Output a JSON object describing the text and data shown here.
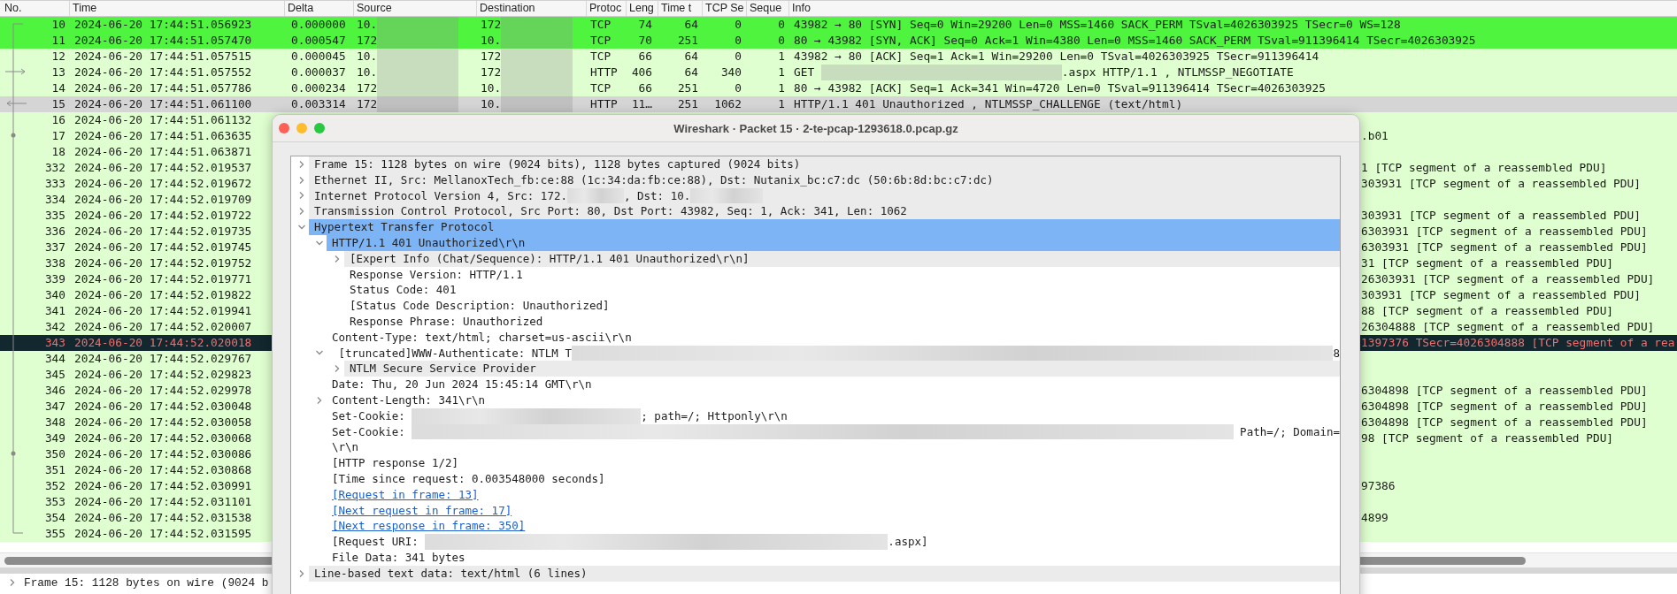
{
  "packet_list": {
    "columns": [
      "No.",
      "Time",
      "Delta",
      "Source",
      "Destination",
      "Protoc",
      "Leng",
      "Time t",
      "TCP Se",
      "Seque",
      "Info"
    ],
    "rows": [
      {
        "kind": "full",
        "cells": [
          "10",
          "2024-06-20 17:44:51.056923",
          "0.000000",
          "10.",
          "172",
          "TCP",
          "74",
          "64",
          "0",
          "0"
        ],
        "info": [
          {
            "text": "43982 → 80 [SYN] Seq=0 Win=29200 Len=0 MSS=1460 SACK_PERM TSval=4026303925 TSecr=0 WS=128"
          }
        ],
        "color": "#4ef43e",
        "selected": false
      },
      {
        "kind": "full",
        "cells": [
          "11",
          "2024-06-20 17:44:51.057470",
          "0.000547",
          "172",
          "10.",
          "TCP",
          "70",
          "251",
          "0",
          "0"
        ],
        "info": [
          {
            "text": "80 → 43982 [SYN, ACK] Seq=0 Ack=1 Win=4380 Len=0 MSS=1460 SACK_PERM TSval=911396414 TSecr=4026303925"
          }
        ],
        "color": "#4ef43e",
        "selected": false
      },
      {
        "kind": "full",
        "cells": [
          "12",
          "2024-06-20 17:44:51.057515",
          "0.000045",
          "10.",
          "172",
          "TCP",
          "66",
          "64",
          "0",
          "1"
        ],
        "info": [
          {
            "text": "43982 → 80 [ACK] Seq=1 Ack=1 Win=29200 Len=0 TSval=4026303925 TSecr=911396414"
          }
        ],
        "color": "#e0ffd0",
        "selected": false
      },
      {
        "kind": "full",
        "cells": [
          "13",
          "2024-06-20 17:44:51.057552",
          "0.000037",
          "10.",
          "172",
          "HTTP",
          "406",
          "64",
          "340",
          "1"
        ],
        "info": [
          {
            "text": "GET "
          },
          {
            "kind": "blur"
          },
          {
            "text": ".aspx HTTP/1.1 , NTLMSSP_NEGOTIATE"
          }
        ],
        "color": "#e0ffd0",
        "selected": false
      },
      {
        "kind": "full",
        "cells": [
          "14",
          "2024-06-20 17:44:51.057786",
          "0.000234",
          "172",
          "10.",
          "TCP",
          "66",
          "251",
          "0",
          "1"
        ],
        "info": [
          {
            "text": "80 → 43982 [ACK] Seq=1 Ack=341 Win=4720 Len=0 TSval=911396414 TSecr=4026303925"
          }
        ],
        "color": "#e0ffd0",
        "selected": false
      },
      {
        "kind": "full",
        "cells": [
          "15",
          "2024-06-20 17:44:51.061100",
          "0.003314",
          "172",
          "10.",
          "HTTP",
          "11…",
          "251",
          "1062",
          "1"
        ],
        "info": [
          {
            "text": "HTTP/1.1 401 Unauthorized , NTLMSSP_CHALLENGE (text/html)"
          }
        ],
        "selected": true
      },
      {
        "kind": "covered",
        "cells": [
          "16",
          "2024-06-20 17:44:51.061132"
        ],
        "color": "#e0ffd0",
        "selected": false
      },
      {
        "kind": "covered",
        "cells": [
          "17",
          "2024-06-20 17:44:51.063635"
        ],
        "info": [
          {
            "text": ".b01"
          }
        ],
        "color": "#e0ffd0",
        "selected": false
      },
      {
        "kind": "covered",
        "cells": [
          "18",
          "2024-06-20 17:44:51.063871"
        ],
        "color": "#e0ffd0",
        "selected": false
      },
      {
        "kind": "covered",
        "cells": [
          "332",
          "2024-06-20 17:44:52.019537"
        ],
        "info": [
          {
            "text": "1 [TCP segment of a reassembled PDU]"
          }
        ],
        "color": "#e0ffd0",
        "selected": false
      },
      {
        "kind": "covered",
        "cells": [
          "333",
          "2024-06-20 17:44:52.019672"
        ],
        "info": [
          {
            "text": "303931 [TCP segment of a reassembled PDU]"
          }
        ],
        "color": "#e0ffd0",
        "selected": false
      },
      {
        "kind": "covered",
        "cells": [
          "334",
          "2024-06-20 17:44:52.019709"
        ],
        "color": "#e0ffd0",
        "selected": false
      },
      {
        "kind": "covered",
        "cells": [
          "335",
          "2024-06-20 17:44:52.019722"
        ],
        "info": [
          {
            "text": "303931 [TCP segment of a reassembled PDU]"
          }
        ],
        "color": "#e0ffd0",
        "selected": false
      },
      {
        "kind": "covered",
        "cells": [
          "336",
          "2024-06-20 17:44:52.019735"
        ],
        "info": [
          {
            "text": "6303931 [TCP segment of a reassembled PDU]"
          }
        ],
        "color": "#e0ffd0",
        "selected": false
      },
      {
        "kind": "covered",
        "cells": [
          "337",
          "2024-06-20 17:44:52.019745"
        ],
        "info": [
          {
            "text": "6303931 [TCP segment of a reassembled PDU]"
          }
        ],
        "color": "#e0ffd0",
        "selected": false
      },
      {
        "kind": "covered",
        "cells": [
          "338",
          "2024-06-20 17:44:52.019752"
        ],
        "info": [
          {
            "text": "31 [TCP segment of a reassembled PDU]"
          }
        ],
        "color": "#e0ffd0",
        "selected": false
      },
      {
        "kind": "covered",
        "cells": [
          "339",
          "2024-06-20 17:44:52.019771"
        ],
        "info": [
          {
            "text": "26303931 [TCP segment of a reassembled PDU]"
          }
        ],
        "color": "#e0ffd0",
        "selected": false
      },
      {
        "kind": "covered",
        "cells": [
          "340",
          "2024-06-20 17:44:52.019822"
        ],
        "info": [
          {
            "text": "303931 [TCP segment of a reassembled PDU]"
          }
        ],
        "color": "#e0ffd0",
        "selected": false
      },
      {
        "kind": "covered",
        "cells": [
          "341",
          "2024-06-20 17:44:52.019941"
        ],
        "info": [
          {
            "text": "88 [TCP segment of a reassembled PDU]"
          }
        ],
        "color": "#e0ffd0",
        "selected": false
      },
      {
        "kind": "covered",
        "cells": [
          "342",
          "2024-06-20 17:44:52.020007"
        ],
        "info": [
          {
            "text": "26304888 [TCP segment of a reassembled PDU]"
          }
        ],
        "color": "#e0ffd0",
        "selected": false
      },
      {
        "kind": "covered",
        "cells": [
          "343",
          "2024-06-20 17:44:52.020018"
        ],
        "info": [
          {
            "text": "1397376 TSecr=4026304888 [TCP segment of a rea"
          }
        ],
        "color": "#12272e",
        "error": true,
        "selected": false
      },
      {
        "kind": "covered",
        "cells": [
          "344",
          "2024-06-20 17:44:52.029767"
        ],
        "color": "#e0ffd0",
        "selected": false
      },
      {
        "kind": "covered",
        "cells": [
          "345",
          "2024-06-20 17:44:52.029823"
        ],
        "color": "#e0ffd0",
        "selected": false
      },
      {
        "kind": "covered",
        "cells": [
          "346",
          "2024-06-20 17:44:52.029978"
        ],
        "info": [
          {
            "text": "6304898 [TCP segment of a reassembled PDU]"
          }
        ],
        "color": "#e0ffd0",
        "selected": false
      },
      {
        "kind": "covered",
        "cells": [
          "347",
          "2024-06-20 17:44:52.030048"
        ],
        "info": [
          {
            "text": "6304898 [TCP segment of a reassembled PDU]"
          }
        ],
        "color": "#e0ffd0",
        "selected": false
      },
      {
        "kind": "covered",
        "cells": [
          "348",
          "2024-06-20 17:44:52.030058"
        ],
        "info": [
          {
            "text": "6304898 [TCP segment of a reassembled PDU]"
          }
        ],
        "color": "#e0ffd0",
        "selected": false
      },
      {
        "kind": "covered",
        "cells": [
          "349",
          "2024-06-20 17:44:52.030068"
        ],
        "info": [
          {
            "text": "98 [TCP segment of a reassembled PDU]"
          }
        ],
        "color": "#e0ffd0",
        "selected": false
      },
      {
        "kind": "covered",
        "cells": [
          "350",
          "2024-06-20 17:44:52.030086"
        ],
        "color": "#e0ffd0",
        "selected": false
      },
      {
        "kind": "covered",
        "cells": [
          "351",
          "2024-06-20 17:44:52.030868"
        ],
        "color": "#e0ffd0",
        "selected": false
      },
      {
        "kind": "covered",
        "cells": [
          "352",
          "2024-06-20 17:44:52.030991"
        ],
        "info": [
          {
            "text": "97386"
          }
        ],
        "color": "#e0ffd0",
        "selected": false
      },
      {
        "kind": "covered",
        "cells": [
          "353",
          "2024-06-20 17:44:52.031101"
        ],
        "color": "#e0ffd0",
        "selected": false
      },
      {
        "kind": "covered",
        "cells": [
          "354",
          "2024-06-20 17:44:52.031538"
        ],
        "info": [
          {
            "text": "4899"
          }
        ],
        "color": "#e0ffd0",
        "selected": false
      },
      {
        "kind": "covered",
        "cells": [
          "355",
          "2024-06-20 17:44:52.031595"
        ],
        "color": "#e0ffd0",
        "selected": false
      }
    ]
  },
  "details_pane": {
    "items": [
      {
        "text": "Frame 15: 1128 bytes on wire (9024 b",
        "expanded": false
      }
    ]
  },
  "packet_window": {
    "title": "Wireshark · Packet 15 · 2-te-pcap-1293618.0.pcap.gz",
    "tree": [
      {
        "kind": "text",
        "parts": [
          {
            "text": "Frame 15: 1128 bytes on wire (9024 bits), 1128 bytes captured (9024 bits)"
          }
        ],
        "expanded": false,
        "shaded": true,
        "selected": false
      },
      {
        "kind": "text",
        "parts": [
          {
            "text": "Ethernet II, Src: MellanoxTech_fb:ce:88 (1c:34:da:fb:ce:88), Dst: Nutanix_bc:c7:dc (50:6b:8d:bc:c7:dc)"
          }
        ],
        "expanded": false,
        "shaded": true,
        "selected": false
      },
      {
        "kind": "text",
        "parts": [
          {
            "text": "Internet Protocol Version 4, Src: 172."
          },
          {
            "kind": "blur"
          },
          {
            "text": ", Dst: 10."
          },
          {
            "kind": "blur"
          }
        ],
        "expanded": false,
        "shaded": true,
        "selected": false
      },
      {
        "kind": "text",
        "parts": [
          {
            "text": "Transmission Control Protocol, Src Port: 80, Dst Port: 43982, Seq: 1, Ack: 341, Len: 1062"
          }
        ],
        "expanded": false,
        "shaded": true,
        "selected": false
      },
      {
        "kind": "text",
        "parts": [
          {
            "text": "Hypertext Transfer Protocol"
          }
        ],
        "expanded": true,
        "selected": true,
        "children": [
          {
            "kind": "text",
            "parts": [
              {
                "text": "HTTP/1.1 401 Unauthorized\\r\\n"
              }
            ],
            "expanded": true,
            "selected": true,
            "children": [
              {
                "kind": "text",
                "parts": [
                  {
                    "text": "[Expert Info (Chat/Sequence): HTTP/1.1 401 Unauthorized\\r\\n]"
                  }
                ],
                "expanded": false,
                "shaded": true,
                "selected": false
              },
              {
                "kind": "text",
                "parts": [
                  {
                    "text": "Response Version: HTTP/1.1"
                  }
                ],
                "shaded": false,
                "selected": false
              },
              {
                "kind": "text",
                "parts": [
                  {
                    "text": "Status Code: 401"
                  }
                ],
                "shaded": false,
                "selected": false
              },
              {
                "kind": "text",
                "parts": [
                  {
                    "text": "[Status Code Description: Unauthorized]"
                  }
                ],
                "shaded": false,
                "selected": false
              },
              {
                "kind": "text",
                "parts": [
                  {
                    "text": "Response Phrase: Unauthorized"
                  }
                ],
                "shaded": false,
                "selected": false
              }
            ]
          },
          {
            "kind": "text",
            "parts": [
              {
                "text": "Content-Type: text/html; charset=us-ascii\\r\\n"
              }
            ],
            "shaded": false,
            "selected": false
          },
          {
            "kind": "text",
            "parts": [
              {
                "text": " [truncated]WWW-Authenticate: NTLM T"
              },
              {
                "kind": "blur"
              },
              {
                "text": "8"
              }
            ],
            "expanded": true,
            "shaded": false,
            "selected": false,
            "children": [
              {
                "kind": "text",
                "parts": [
                  {
                    "text": "NTLM Secure Service Provider"
                  }
                ],
                "expanded": false,
                "shaded": true,
                "selected": false
              }
            ]
          },
          {
            "kind": "text",
            "parts": [
              {
                "text": "Date: Thu, 20 Jun 2024 15:45:14 GMT\\r\\n"
              }
            ],
            "shaded": false,
            "selected": false
          },
          {
            "kind": "text",
            "parts": [
              {
                "text": "Content-Length: 341\\r\\n"
              }
            ],
            "expanded": false,
            "shaded": false,
            "selected": false
          },
          {
            "kind": "text",
            "parts": [
              {
                "text": "Set-Cookie: "
              },
              {
                "kind": "blur"
              },
              {
                "text": "; path=/; Httponly\\r\\n"
              }
            ],
            "shaded": false,
            "selected": false
          },
          {
            "kind": "text",
            "parts": [
              {
                "text": "Set-Cookie: "
              },
              {
                "kind": "blur"
              },
              {
                "text": " Path=/; Domain="
              }
            ],
            "shaded": false,
            "selected": false
          },
          {
            "kind": "text",
            "parts": [
              {
                "text": "\\r\\n"
              }
            ],
            "shaded": false,
            "selected": false
          },
          {
            "kind": "text",
            "parts": [
              {
                "text": "[HTTP response 1/2]"
              }
            ],
            "shaded": false,
            "selected": false
          },
          {
            "kind": "text",
            "parts": [
              {
                "text": "[Time since request: 0.003548000 seconds]"
              }
            ],
            "shaded": false,
            "selected": false
          },
          {
            "kind": "link",
            "parts": [
              {
                "text": "[Request in frame: 13]"
              }
            ],
            "shaded": false,
            "selected": false
          },
          {
            "kind": "link",
            "parts": [
              {
                "text": "[Next request in frame: 17]"
              }
            ],
            "shaded": false,
            "selected": false
          },
          {
            "kind": "link",
            "parts": [
              {
                "text": "[Next response in frame: 350]"
              }
            ],
            "shaded": false,
            "selected": false
          },
          {
            "kind": "text",
            "parts": [
              {
                "text": "[Request URI: "
              },
              {
                "kind": "blur"
              },
              {
                "text": ".aspx]"
              }
            ],
            "shaded": false,
            "selected": false
          },
          {
            "kind": "text",
            "parts": [
              {
                "text": "File Data: 341 bytes"
              }
            ],
            "shaded": false,
            "selected": false
          }
        ]
      },
      {
        "kind": "text",
        "parts": [
          {
            "text": "Line-based text data: text/html (6 lines)"
          }
        ],
        "expanded": false,
        "shaded": true,
        "selected": false
      }
    ]
  }
}
